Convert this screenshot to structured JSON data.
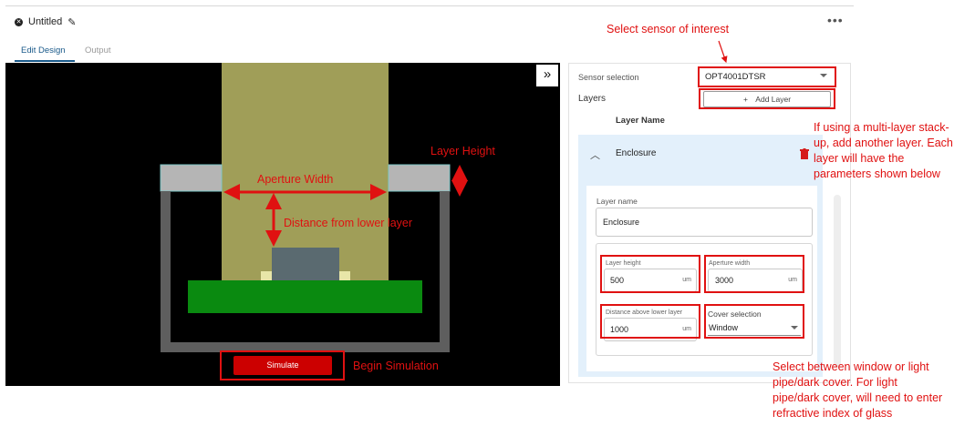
{
  "header": {
    "title": "Untitled",
    "menu": "•••"
  },
  "tabs": [
    {
      "label": "Edit Design"
    },
    {
      "label": "Output"
    }
  ],
  "canvas": {
    "collapse_glyph": "»",
    "labels": {
      "aperture_width": "Aperture Width",
      "layer_height": "Layer Height",
      "distance": "Distance from lower layer"
    },
    "simulate_label": "Simulate",
    "begin_simulation": "Begin Simulation"
  },
  "panel": {
    "sensor_label": "Sensor selection",
    "sensor_value": "OPT4001DTSR",
    "layers_label": "Layers",
    "add_layer_label": "Add Layer",
    "layer_name_header": "Layer Name",
    "layer": {
      "name": "Enclosure",
      "layer_name_label": "Layer name",
      "layer_name_value": "Enclosure",
      "layer_height_label": "Layer height",
      "layer_height_value": "500",
      "aperture_width_label": "Aperture width",
      "aperture_width_value": "3000",
      "distance_label": "Distance above lower layer",
      "distance_value": "1000",
      "unit": "um",
      "cover_label": "Cover selection",
      "cover_value": "Window"
    }
  },
  "annotations": {
    "select_sensor": "Select sensor of interest",
    "multi_layer": [
      "If using a multi-layer stack-",
      "up, add another layer. Each",
      "layer will have the",
      "parameters shown below"
    ],
    "cover_note": [
      "Select between window or light",
      "pipe/dark cover. For light",
      "pipe/dark cover, will need to enter",
      "refractive index of glass"
    ]
  },
  "colors": {
    "accent_red": "#e01111",
    "simulate_button": "#cc0000",
    "tab_active": "#1a5a8a",
    "light_beam": "#a09e58",
    "pcb": "#0a8a10",
    "enclosure": "#5e5e5e",
    "aperture": "#b5b5b5",
    "sensor": "#5a6a70"
  }
}
